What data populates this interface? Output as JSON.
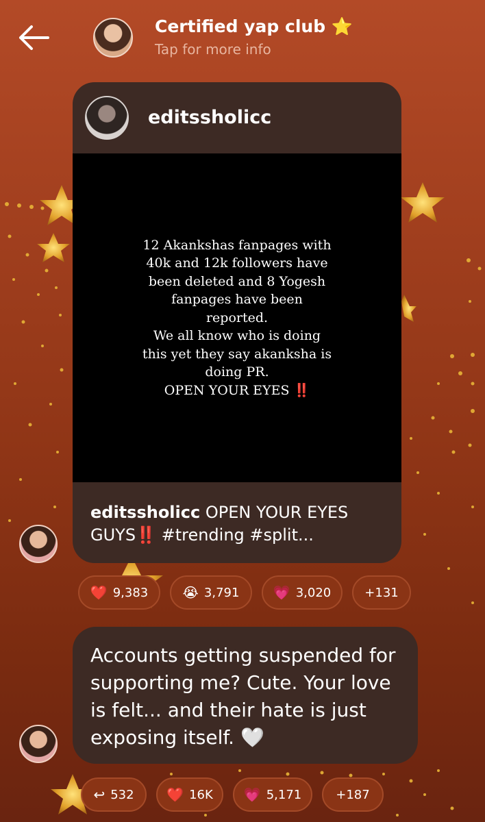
{
  "header": {
    "title": "Certified yap club",
    "title_emoji": "⭐",
    "subtitle": "Tap for more info"
  },
  "shared_post": {
    "username": "editssholicc",
    "image_text_lines": [
      "12 Akankshas fanpages with",
      "40k and 12k followers have",
      "been deleted and 8 Yogesh",
      "fanpages have been",
      "reported.",
      "We all know who is doing",
      "this yet they say akanksha is",
      "doing PR.",
      "OPEN YOUR EYES"
    ],
    "image_text_emoji": "‼️",
    "caption_user": "editssholicc",
    "caption_text": " OPEN YOUR EYES GUYS",
    "caption_emoji": "‼️",
    "caption_tags": " #trending #split..."
  },
  "post_reactions": [
    {
      "emoji": "❤️",
      "icon": "red-heart-icon",
      "count": "9,383"
    },
    {
      "emoji": "😭",
      "icon": "crying-face-icon",
      "count": "3,791"
    },
    {
      "emoji": "💗",
      "icon": "pink-heart-icon",
      "count": "3,020"
    },
    {
      "emoji": "",
      "icon": "",
      "count": "+131"
    }
  ],
  "message": {
    "text": "Accounts getting suspended for supporting me? Cute. Your love is felt... and their hate is just exposing itself.",
    "emoji": "🤍"
  },
  "message_reactions": [
    {
      "emoji": "↩",
      "icon": "reply-icon",
      "count": "532"
    },
    {
      "emoji": "❤️",
      "icon": "red-heart-icon",
      "count": "16K"
    },
    {
      "emoji": "💗",
      "icon": "pink-heart-icon",
      "count": "5,171"
    },
    {
      "emoji": "",
      "icon": "",
      "count": "+187"
    }
  ],
  "colors": {
    "background_top": "#b34a27",
    "background_bottom": "#6a2410",
    "card": "#3d2a24",
    "pill": "#8a3415",
    "exclamation": "#e02424"
  }
}
